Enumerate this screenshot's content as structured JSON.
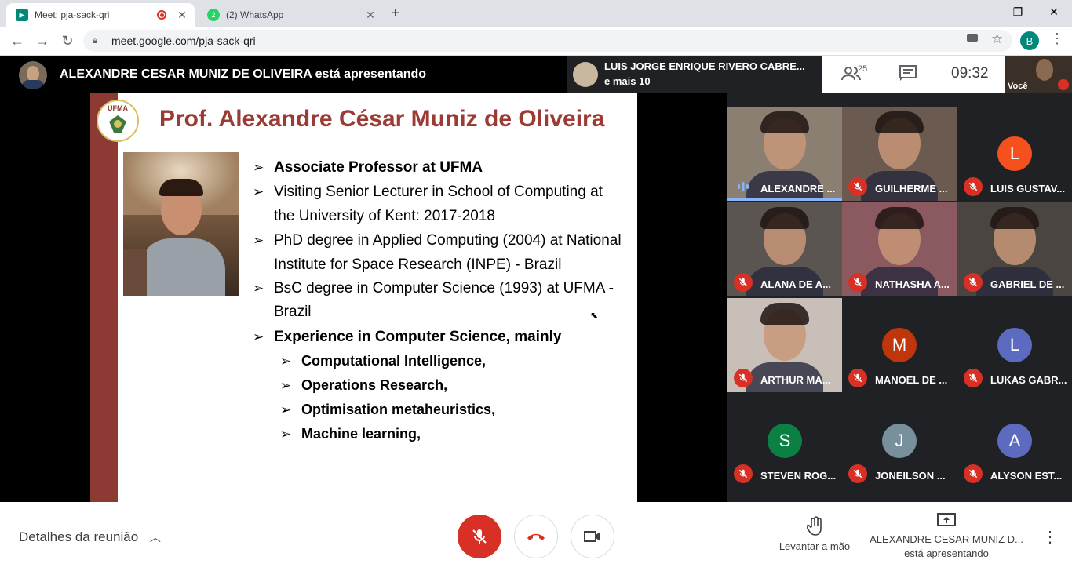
{
  "browser": {
    "tabs": [
      {
        "title": "Meet: pja-sack-qri",
        "active": true
      },
      {
        "title": "(2) WhatsApp",
        "active": false
      }
    ],
    "new_tab": "+",
    "url": "meet.google.com/pja-sack-qri",
    "profile_initial": "B"
  },
  "meet_header": {
    "presenting_text": "ALEXANDRE CESAR MUNIZ DE OLIVEIRA está apresentando",
    "speaker_name": "LUIS JORGE ENRIQUE RIVERO CABRE...",
    "speaker_more": "e mais 10",
    "participant_count": "25",
    "time": "09:32",
    "self_label": "Você"
  },
  "slide": {
    "logo_text": "UFMA",
    "title": "Prof. Alexandre César Muniz de Oliveira",
    "bullets": [
      {
        "text": "Associate Professor at UFMA",
        "bold": true,
        "level": 1
      },
      {
        "text": "Visiting Senior Lecturer in School of Computing at",
        "bold": false,
        "level": 1
      },
      {
        "text": "the University of Kent: 2017-2018",
        "bold": false,
        "level": 0
      },
      {
        "text": "PhD degree in Applied Computing (2004) at National",
        "bold": false,
        "level": 1
      },
      {
        "text": "Institute for Space Research (INPE) - Brazil",
        "bold": false,
        "level": 0
      },
      {
        "text": "BsC degree in Computer Science (1993) at UFMA -",
        "bold": false,
        "level": 1
      },
      {
        "text": "Brazil",
        "bold": false,
        "level": 0
      },
      {
        "text": "Experience in Computer Science, mainly",
        "bold": true,
        "level": 1
      },
      {
        "text": "Computational Intelligence,",
        "bold": true,
        "level": 2
      },
      {
        "text": "Operations Research,",
        "bold": true,
        "level": 2
      },
      {
        "text": "Optimisation metaheuristics,",
        "bold": true,
        "level": 2
      },
      {
        "text": "Machine learning,",
        "bold": true,
        "level": 2
      }
    ]
  },
  "participants": [
    {
      "name": "ALEXANDRE ...",
      "video": true,
      "speaking": true,
      "bg": "#8a7f70"
    },
    {
      "name": "GUILHERME ...",
      "video": true,
      "bg": "#6b5a50"
    },
    {
      "name": "LUIS GUSTAV...",
      "initial": "L",
      "color": "#f4511e"
    },
    {
      "name": "ALANA DE A...",
      "video": true,
      "bg": "#5a5550"
    },
    {
      "name": "NATHASHA A...",
      "video": true,
      "bg": "#8a5a60"
    },
    {
      "name": "GABRIEL DE ...",
      "video": true,
      "bg": "#4a4540"
    },
    {
      "name": "ARTHUR MA...",
      "video": true,
      "bg": "#c8c0b8"
    },
    {
      "name": "MANOEL DE ...",
      "initial": "M",
      "color": "#bf360c"
    },
    {
      "name": "LUKAS GABR...",
      "initial": "L",
      "color": "#5c6bc0"
    },
    {
      "name": "STEVEN ROG...",
      "initial": "S",
      "color": "#0b8043"
    },
    {
      "name": "JONEILSON ...",
      "initial": "J",
      "color": "#78909c"
    },
    {
      "name": "ALYSON EST...",
      "initial": "A",
      "color": "#5c6bc0"
    }
  ],
  "bottom": {
    "details_label": "Detalhes da reunião",
    "raise_hand_label": "Levantar a mão",
    "presenting_line1": "ALEXANDRE CESAR MUNIZ D...",
    "presenting_line2": "está apresentando"
  },
  "colors": {
    "mic_off_red": "#d93025",
    "slide_title": "#9b3b34",
    "slide_bar": "#8c3a33"
  }
}
